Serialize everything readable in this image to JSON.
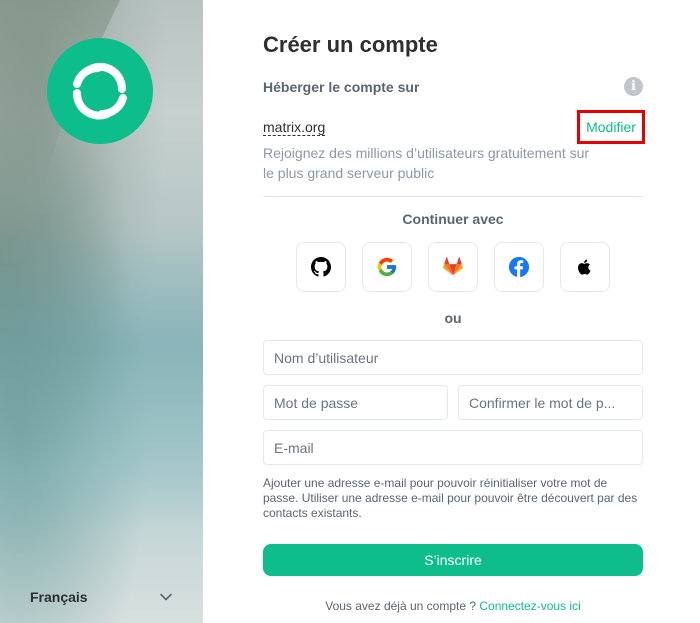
{
  "sidebar": {
    "language": "Français"
  },
  "form": {
    "title": "Créer un compte",
    "host_label": "Héberger le compte sur",
    "info_glyph": "i",
    "server_name": "matrix.org",
    "modify_label": "Modifier",
    "server_description": "Rejoignez des millions d’utilisateurs gratuitement sur le plus grand serveur public",
    "continue_with": "Continuer avec",
    "sso_providers": [
      "github-icon",
      "google-icon",
      "gitlab-icon",
      "facebook-icon",
      "apple-icon"
    ],
    "or_label": "ou",
    "username_placeholder": "Nom d’utilisateur",
    "password_placeholder": "Mot de passe",
    "confirm_placeholder": "Confirmer le mot de p...",
    "email_placeholder": "E-mail",
    "email_help": "Ajouter une adresse e-mail pour pouvoir réinitialiser votre mot de passe. Utiliser une adresse e-mail pour pouvoir être découvert par des contacts existants.",
    "register_label": "S’inscrire",
    "login_prompt": "Vous avez déjà un compte ?",
    "login_link": "Connectez-vous ici"
  },
  "colors": {
    "accent": "#0dbd8b",
    "highlight": "#e60000",
    "text_primary": "#2e2f32",
    "text_secondary": "#8d97a5"
  }
}
